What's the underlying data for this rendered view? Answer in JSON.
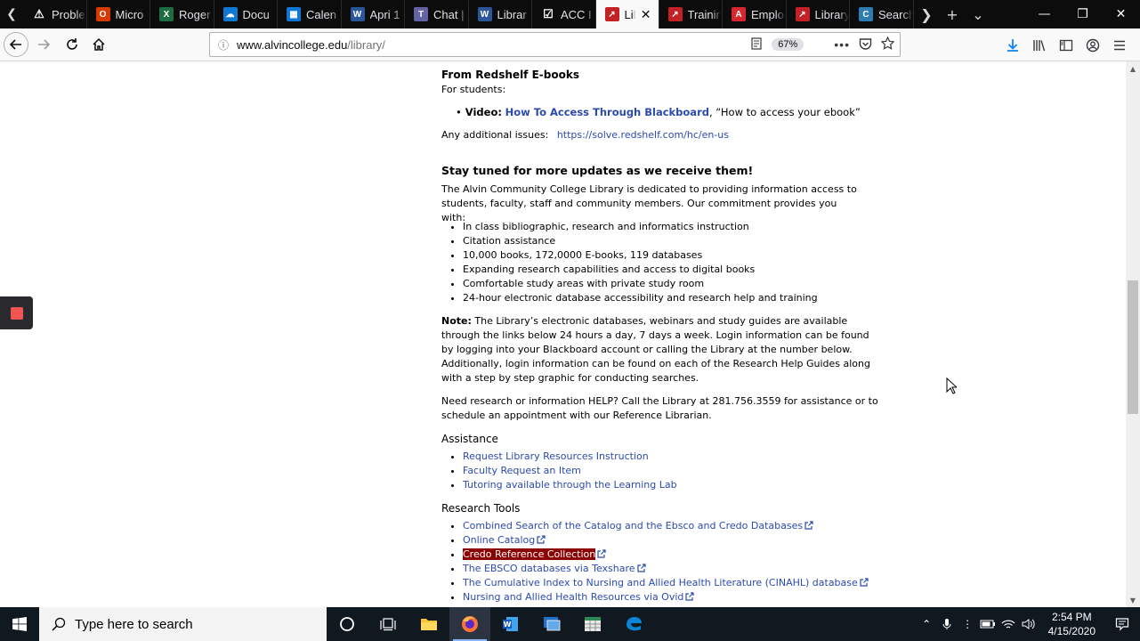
{
  "tabs": [
    {
      "label": "Proble",
      "icon": "warning-icon",
      "color": "#ffffff"
    },
    {
      "label": "Micro",
      "icon": "office-icon",
      "color": "#d83b01"
    },
    {
      "label": "Roger",
      "icon": "excel-icon",
      "color": "#1d6f42"
    },
    {
      "label": "Docu",
      "icon": "onedrive-icon",
      "color": "#0f78d4"
    },
    {
      "label": "Calen",
      "icon": "calendar-icon",
      "color": "#0f78d4"
    },
    {
      "label": "Apri 1",
      "icon": "word-icon",
      "color": "#2b579a"
    },
    {
      "label": "Chat |",
      "icon": "teams-icon",
      "color": "#6264a7"
    },
    {
      "label": "Librar",
      "icon": "word-icon",
      "color": "#2b579a"
    },
    {
      "label": "ACC I",
      "icon": "checkbox-icon",
      "color": "#ffffff"
    },
    {
      "label": "Lib",
      "icon": "pdf-icon",
      "color": "#c42127",
      "active": true
    },
    {
      "label": "Trainir",
      "icon": "pdf-icon",
      "color": "#c42127"
    },
    {
      "label": "Emplo",
      "icon": "acrobat-icon",
      "color": "#d7262d"
    },
    {
      "label": "Library",
      "icon": "pdf-icon",
      "color": "#c42127"
    },
    {
      "label": "Search",
      "icon": "credo-icon",
      "color": "#2d7db3"
    }
  ],
  "url": {
    "host": "www.alvincollege.edu",
    "path": "/library/"
  },
  "zoom": "67%",
  "page": {
    "redshelf_heading": "From Redshelf E-books",
    "for_students": "For students:",
    "video_label": "Video:",
    "video_link": "How To Access Through Blackboard",
    "video_suffix": ", “How to access your ebook”",
    "additional_label": "Any additional issues:",
    "additional_link": "https://solve.redshelf.com/hc/en-us",
    "stay_tuned": "Stay tuned for more updates as we receive them!",
    "intro": "The Alvin Community College Library is dedicated to providing information access to students, faculty, staff and community members. Our commitment provides you with:",
    "features": [
      "In class bibliographic, research and informatics instruction",
      "Citation assistance",
      "10,000 books, 172,0000 E-books, 119 databases",
      "Expanding research capabilities and access to digital books",
      "Comfortable study areas with private study room",
      "24-hour electronic database accessibility and research help and training"
    ],
    "note_label": "Note:",
    "note_text": " The Library’s electronic databases, webinars and study guides are available through the links below 24 hours a day, 7 days a week. Login information can be found by logging into your Blackboard account or calling the Library at the number below. Additionally, login information can be found on each of the Research Help Guides along with a step by step graphic for conducting searches.",
    "help_text": "Need research or information HELP? Call the Library at 281.756.3559 for assistance or to schedule an appointment with our Reference Librarian.",
    "assistance_heading": "Assistance",
    "assistance_links": [
      "Request Library Resources Instruction",
      "Faculty Request an Item",
      "Tutoring available through the Learning Lab"
    ],
    "tools_heading": "Research Tools",
    "tools_links": [
      "Combined Search of the Catalog and the Ebsco and Credo Databases",
      "Online Catalog",
      "Credo Reference Collection",
      "The EBSCO databases via Texshare",
      "The Cumulative Index to Nursing and Allied Health Literature (CINAHL) database",
      "Nursing and Allied Health Resources via Ovid"
    ],
    "highlighted_index": 2
  },
  "taskbar": {
    "search_placeholder": "Type here to search",
    "time": "2:54 PM",
    "date": "4/15/2020"
  }
}
